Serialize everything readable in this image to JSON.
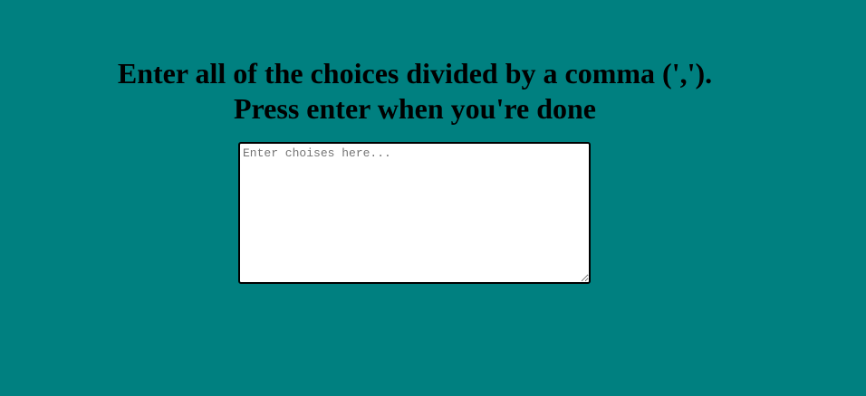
{
  "page": {
    "background_color": "#008080",
    "heading_line_1": "Enter all of the choices divided by a comma (',').",
    "heading_line_2": "Press enter when you're done"
  },
  "choices_input": {
    "value": "",
    "placeholder": "Enter choises here..."
  }
}
